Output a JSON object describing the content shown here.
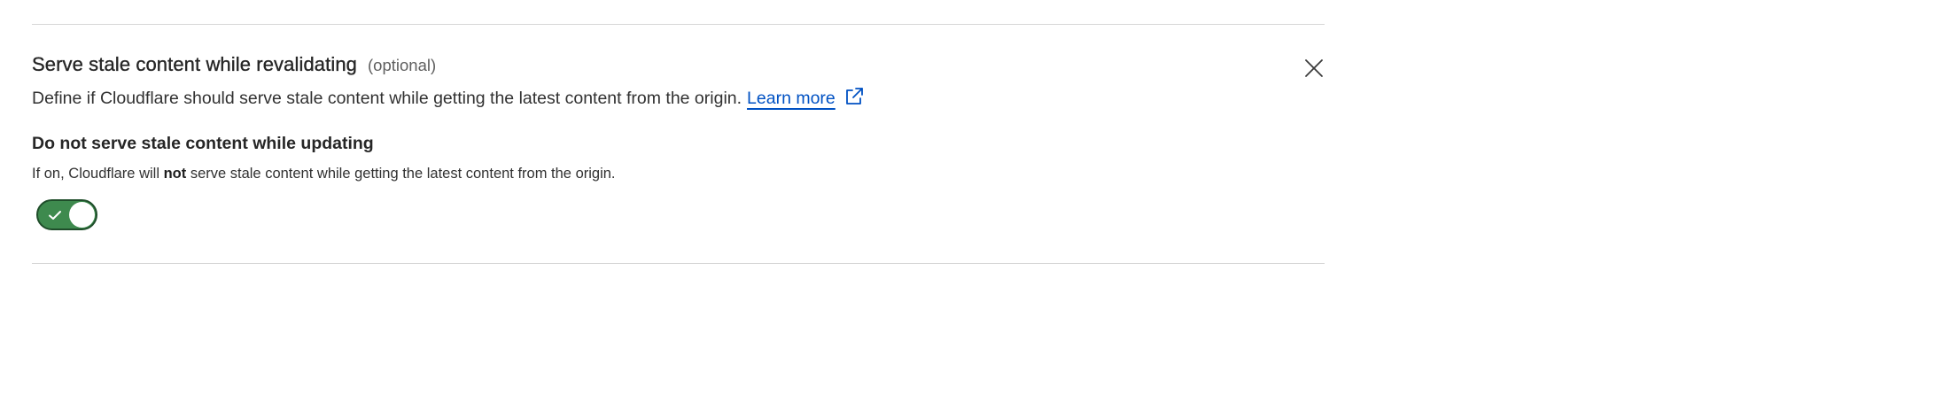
{
  "section": {
    "title": "Serve stale content while revalidating",
    "optional_label": "(optional)",
    "description": "Define if Cloudflare should serve stale content while getting the latest content from the origin.",
    "learn_more_label": "Learn more",
    "close_icon": "close-icon",
    "external_link_icon": "external-link-icon"
  },
  "setting": {
    "heading": "Do not serve stale content while updating",
    "help_prefix": "If on, Cloudflare will",
    "help_emphasis": "not",
    "help_suffix": "serve stale content while getting the latest content from the origin.",
    "toggle": {
      "state": "on",
      "icon": "checkmark-icon",
      "track_color": "#3e8a4e",
      "border_color": "#1f4d2a"
    }
  },
  "colors": {
    "link": "#0051c3",
    "text": "#313131",
    "divider": "#d6d6d6"
  }
}
